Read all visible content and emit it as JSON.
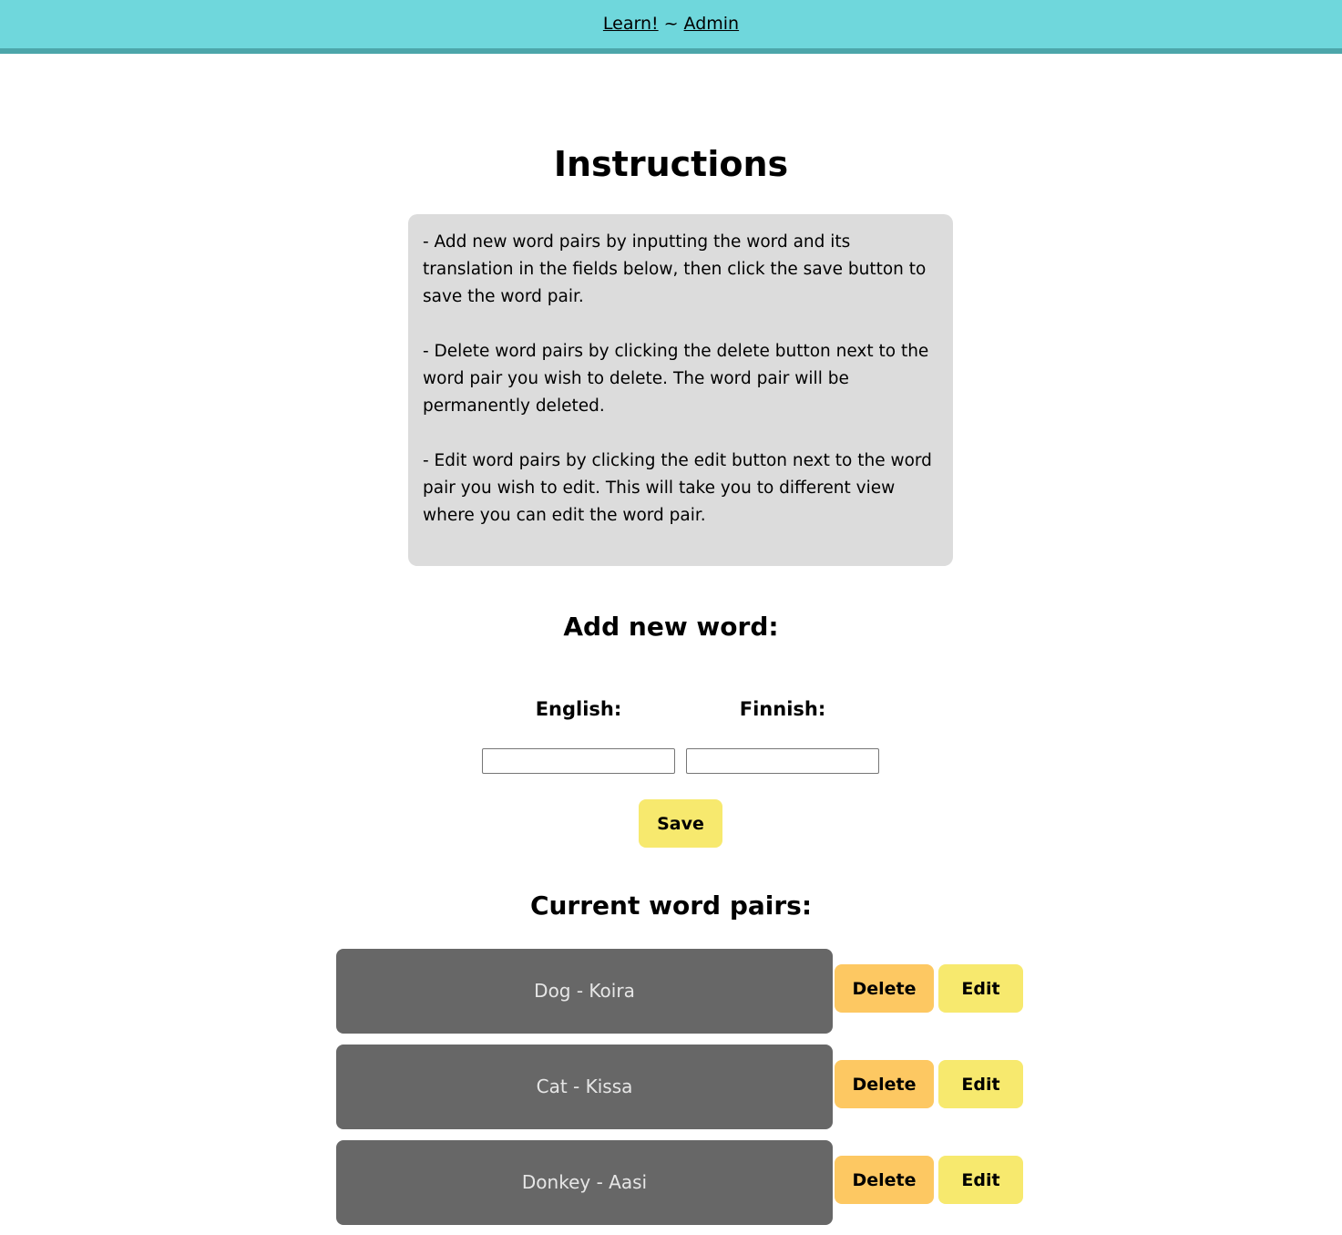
{
  "nav": {
    "learn_label": "Learn!",
    "separator": "~",
    "admin_label": "Admin"
  },
  "instructions": {
    "title": "Instructions",
    "items": [
      "- Add new word pairs by inputting the word and its translation in the fields below, then click the save button to save the word pair.",
      "- Delete word pairs by clicking the delete button next to the word pair you wish to delete. The word pair will be permanently deleted.",
      "- Edit word pairs by clicking the edit button next to the word pair you wish to edit. This will take you to different view where you can edit the word pair."
    ]
  },
  "add_form": {
    "heading": "Add new word:",
    "english_label": "English:",
    "finnish_label": "Finnish:",
    "english_value": "",
    "finnish_value": "",
    "save_label": "Save"
  },
  "word_pairs": {
    "heading": "Current word pairs:",
    "delete_label": "Delete",
    "edit_label": "Edit",
    "items": [
      {
        "text": "Dog - Koira"
      },
      {
        "text": "Cat - Kissa"
      },
      {
        "text": "Donkey - Aasi"
      }
    ]
  },
  "colors": {
    "navbar": "#6fd7dc",
    "navbar_border": "#4ca6aa",
    "instructions_bg": "#dcdcdc",
    "pair_bg": "#676767",
    "delete_btn": "#fdc862",
    "edit_save_btn": "#f7e96e"
  }
}
